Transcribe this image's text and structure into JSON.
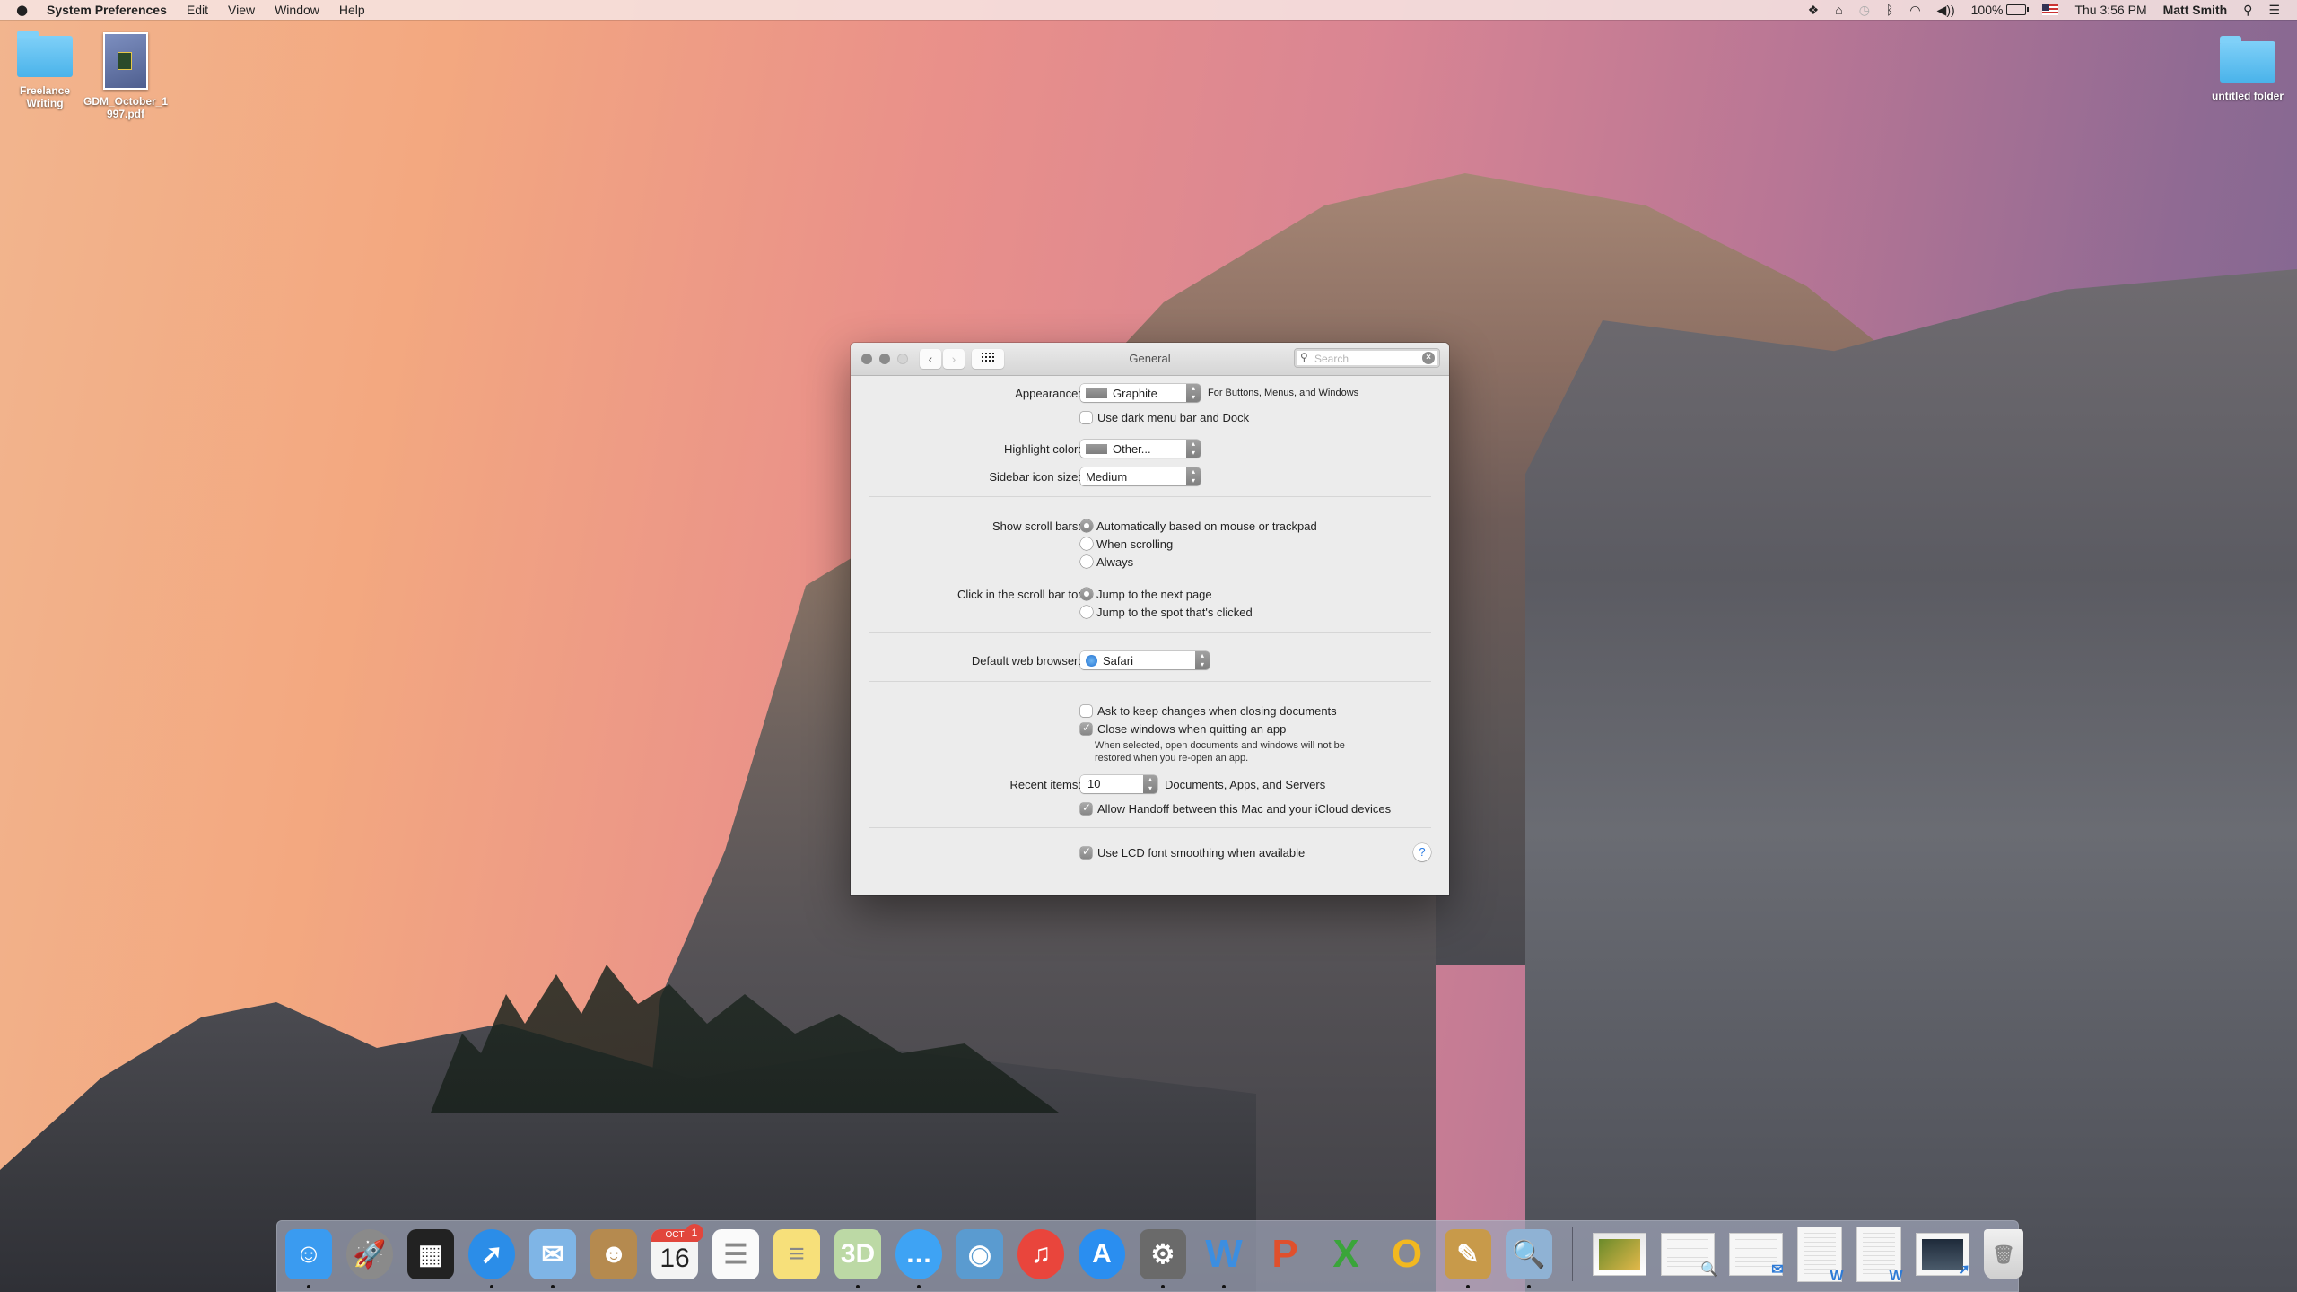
{
  "menubar": {
    "apple_icon": "apple-logo",
    "app_name": "System Preferences",
    "menus": [
      "Edit",
      "View",
      "Window",
      "Help"
    ],
    "status": {
      "dropbox_icon": "dropbox-icon",
      "home_icon": "home-sharing-icon",
      "time_machine_icon": "time-machine-icon",
      "bluetooth_icon": "bluetooth-icon",
      "wifi_icon": "wifi-icon",
      "volume_icon": "volume-icon",
      "battery_percent": "100%",
      "input_source_icon": "us-flag-icon",
      "clock": "Thu 3:56 PM",
      "user": "Matt Smith",
      "spotlight_icon": "spotlight-icon",
      "notification_icon": "notification-center-icon"
    }
  },
  "desktop": {
    "icons": [
      {
        "label": "Freelance Writing",
        "type": "folder"
      },
      {
        "label": "GDM_October_1997.pdf",
        "type": "pdf"
      },
      {
        "label": "untitled folder",
        "type": "folder"
      }
    ]
  },
  "window": {
    "title": "General",
    "search_placeholder": "Search",
    "search_value": "",
    "appearance": {
      "label": "Appearance:",
      "value": "Graphite",
      "hint": "For Buttons, Menus, and Windows"
    },
    "dark_menu": {
      "label": "Use dark menu bar and Dock",
      "checked": false
    },
    "highlight_color": {
      "label": "Highlight color:",
      "value": "Other..."
    },
    "sidebar_icon_size": {
      "label": "Sidebar icon size:",
      "value": "Medium"
    },
    "show_scroll_bars": {
      "label": "Show scroll bars:",
      "options": [
        "Automatically based on mouse or trackpad",
        "When scrolling",
        "Always"
      ],
      "selected": 0
    },
    "click_scroll_bar": {
      "label": "Click in the scroll bar to:",
      "options": [
        "Jump to the next page",
        "Jump to the spot that's clicked"
      ],
      "selected": 0
    },
    "default_browser": {
      "label": "Default web browser:",
      "value": "Safari"
    },
    "ask_keep_changes": {
      "label": "Ask to keep changes when closing documents",
      "checked": false
    },
    "close_windows": {
      "label": "Close windows when quitting an app",
      "checked": true,
      "note_line1": "When selected, open documents and windows will not be",
      "note_line2": "restored when you re-open an app."
    },
    "recent_items": {
      "label": "Recent items:",
      "value": "10",
      "suffix": "Documents, Apps, and Servers"
    },
    "handoff": {
      "label": "Allow Handoff between this Mac and your iCloud devices",
      "checked": true
    },
    "lcd_smoothing": {
      "label": "Use LCD font smoothing when available",
      "checked": true
    },
    "help_label": "?"
  },
  "dock": {
    "apps": [
      {
        "name": "Finder",
        "running": true,
        "glyph": "☺",
        "color": "#3a9bf0"
      },
      {
        "name": "Launchpad",
        "running": false,
        "glyph": "🚀",
        "color": "#8a8a8a"
      },
      {
        "name": "Mission Control",
        "running": false,
        "glyph": "▦",
        "color": "#222222"
      },
      {
        "name": "Safari",
        "running": true,
        "glyph": "➚",
        "color": "#2b8de8"
      },
      {
        "name": "Mail",
        "running": true,
        "glyph": "✉",
        "color": "#7fb5e6"
      },
      {
        "name": "Contacts",
        "running": false,
        "glyph": "☻",
        "color": "#b58a4f"
      },
      {
        "name": "Calendar",
        "running": false,
        "glyph": "16",
        "color": "#f4f4f4",
        "badge": "1",
        "month": "OCT"
      },
      {
        "name": "Reminders",
        "running": false,
        "glyph": "☰",
        "color": "#fafafa"
      },
      {
        "name": "Notes",
        "running": false,
        "glyph": "≡",
        "color": "#f7e07a"
      },
      {
        "name": "Maps",
        "running": true,
        "glyph": "3D",
        "color": "#bcd9a5"
      },
      {
        "name": "Messages",
        "running": true,
        "glyph": "…",
        "color": "#3ea3f4"
      },
      {
        "name": "iPhoto",
        "running": false,
        "glyph": "◉",
        "color": "#5a9bd0"
      },
      {
        "name": "iTunes",
        "running": false,
        "glyph": "♫",
        "color": "#e9453c"
      },
      {
        "name": "App Store",
        "running": false,
        "glyph": "A",
        "color": "#2a8ef0"
      },
      {
        "name": "System Preferences",
        "running": true,
        "glyph": "⚙",
        "color": "#6a6a6a"
      },
      {
        "name": "Microsoft Word",
        "running": true,
        "glyph": "W",
        "color": "#3c8ee0"
      },
      {
        "name": "Microsoft PowerPoint",
        "running": false,
        "glyph": "P",
        "color": "#e0502c"
      },
      {
        "name": "Microsoft Excel",
        "running": false,
        "glyph": "X",
        "color": "#3aa53a"
      },
      {
        "name": "Microsoft Outlook",
        "running": false,
        "glyph": "O",
        "color": "#f2b820"
      },
      {
        "name": "Preview Edit",
        "running": true,
        "glyph": "✎",
        "color": "#c89a4a"
      },
      {
        "name": "Preview",
        "running": true,
        "glyph": "🔍",
        "color": "#8fb2d4"
      }
    ],
    "documents": [
      {
        "name": "monitor-image",
        "mini": ""
      },
      {
        "name": "preview-document",
        "mini": "🔍"
      },
      {
        "name": "mail-document",
        "mini": "✉"
      },
      {
        "name": "word-document-1",
        "mini": "W"
      },
      {
        "name": "word-document-2",
        "mini": "W"
      },
      {
        "name": "safari-webpage",
        "mini": "➚"
      },
      {
        "name": "Trash",
        "mini": ""
      }
    ]
  }
}
